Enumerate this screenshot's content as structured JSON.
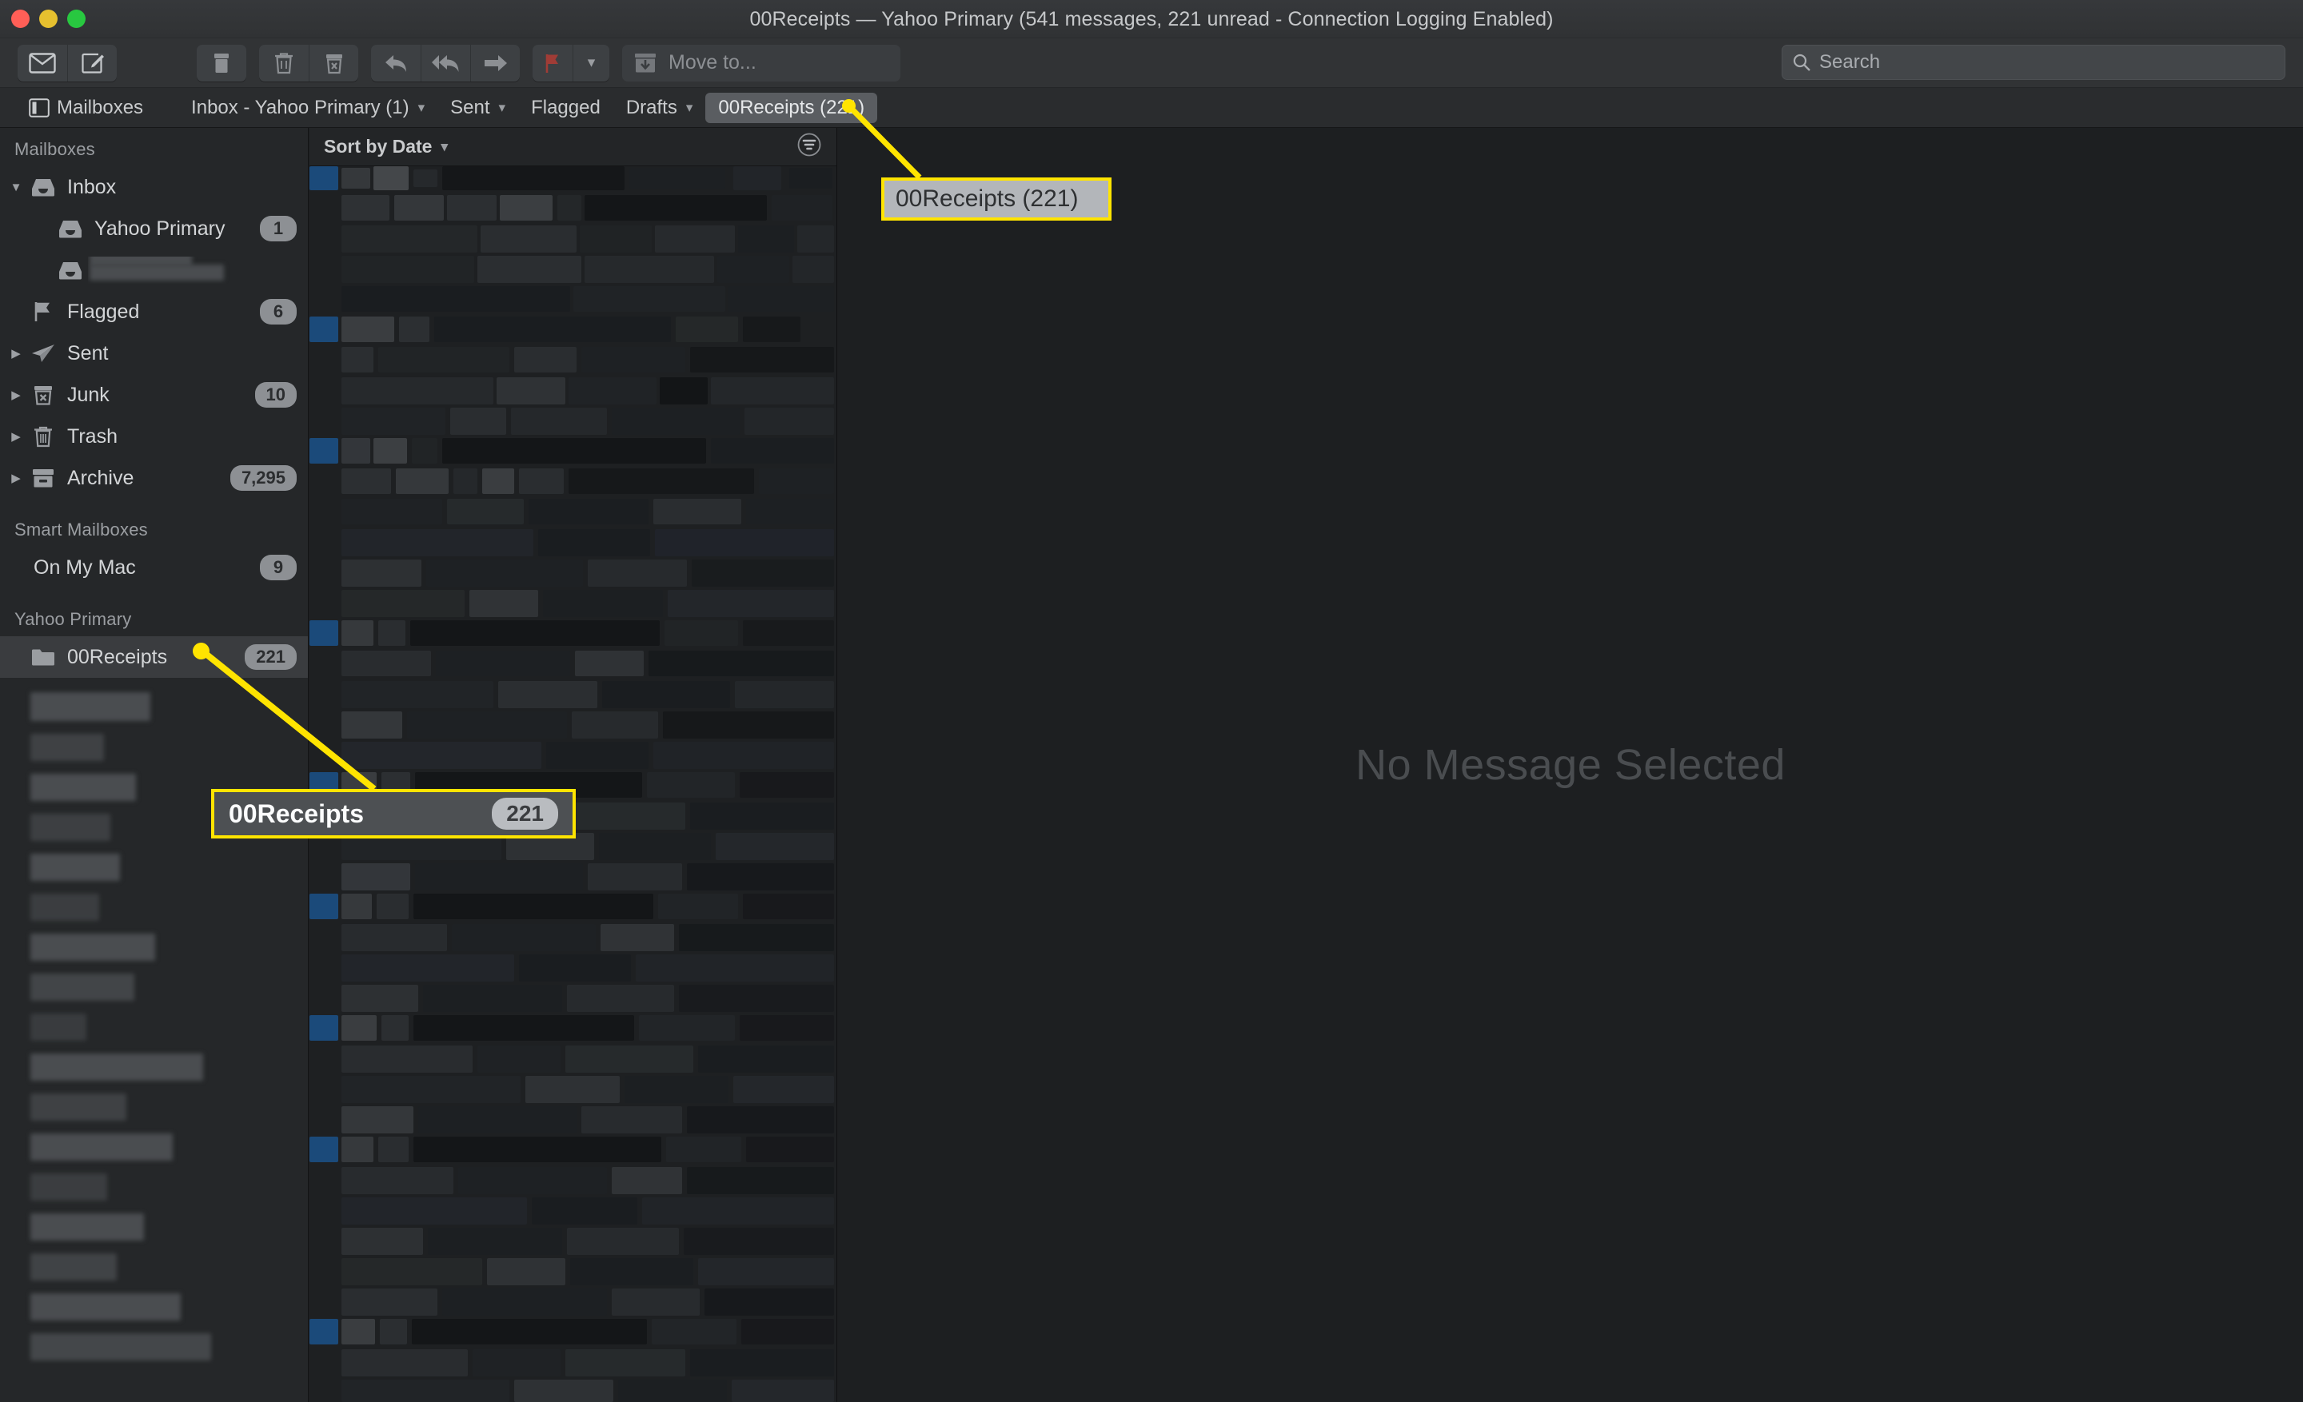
{
  "window": {
    "title": "00Receipts — Yahoo Primary (541 messages, 221 unread - Connection Logging Enabled)"
  },
  "toolbar": {
    "get_mail_label": "get-mail-icon",
    "compose_label": "compose-icon",
    "archive_label": "archive-icon",
    "delete_label": "trash-icon",
    "junk_label": "junk-icon",
    "reply_label": "reply-icon",
    "reply_all_label": "reply-all-icon",
    "forward_label": "forward-icon",
    "flag_label": "flag-icon",
    "move_to_label": "Move to..."
  },
  "search": {
    "placeholder": "Search",
    "value": ""
  },
  "favorites": {
    "mailboxes_label": "Mailboxes",
    "items": [
      {
        "label": "Inbox - Yahoo Primary (1)",
        "has_chevron": true,
        "active": false
      },
      {
        "label": "Sent",
        "has_chevron": true,
        "active": false
      },
      {
        "label": "Flagged",
        "has_chevron": false,
        "active": false
      },
      {
        "label": "Drafts",
        "has_chevron": true,
        "active": false
      },
      {
        "label": "00Receipts (221)",
        "has_chevron": false,
        "active": true
      }
    ]
  },
  "sidebar": {
    "sections": [
      {
        "header": "Mailboxes",
        "items": [
          {
            "label": "Inbox",
            "icon": "inbox-icon",
            "count": "",
            "disclosure": "open",
            "indent": 0
          },
          {
            "label": "Yahoo Primary",
            "icon": "inbox-icon",
            "count": "1",
            "disclosure": "none",
            "indent": 1
          },
          {
            "label": "",
            "icon": "inbox-icon",
            "count": "",
            "disclosure": "none",
            "indent": 1,
            "redacted": true
          },
          {
            "label": "Flagged",
            "icon": "flag-icon",
            "count": "6",
            "disclosure": "none",
            "indent": 0
          },
          {
            "label": "Sent",
            "icon": "sent-icon",
            "count": "",
            "disclosure": "closed",
            "indent": 0
          },
          {
            "label": "Junk",
            "icon": "junk-icon",
            "count": "10",
            "disclosure": "closed",
            "indent": 0
          },
          {
            "label": "Trash",
            "icon": "trash-icon",
            "count": "",
            "disclosure": "closed",
            "indent": 0
          },
          {
            "label": "Archive",
            "icon": "archive-icon",
            "count": "7,295",
            "disclosure": "closed",
            "indent": 0
          }
        ]
      },
      {
        "header": "Smart Mailboxes",
        "items": [
          {
            "label": "On My Mac",
            "icon": "none",
            "count": "9",
            "disclosure": "none",
            "indent": 0
          }
        ]
      },
      {
        "header": "Yahoo Primary",
        "items": [
          {
            "label": "00Receipts",
            "icon": "folder-icon",
            "count": "221",
            "disclosure": "none",
            "indent": 1,
            "selected": true
          }
        ]
      }
    ]
  },
  "message_list": {
    "sort_label": "Sort by Date",
    "filter_icon": "filter-icon",
    "redacted": true
  },
  "reading_pane": {
    "empty_state": "No Message Selected"
  },
  "callouts": [
    {
      "id": "tab",
      "text": "00Receipts (221)"
    },
    {
      "id": "sidebar",
      "label": "00Receipts",
      "badge": "221"
    }
  ],
  "colors": {
    "accent": "#ffe400",
    "unread_blue": "#1b4a7a",
    "titlebar": "#343639",
    "sidebar_bg": "#252729"
  }
}
